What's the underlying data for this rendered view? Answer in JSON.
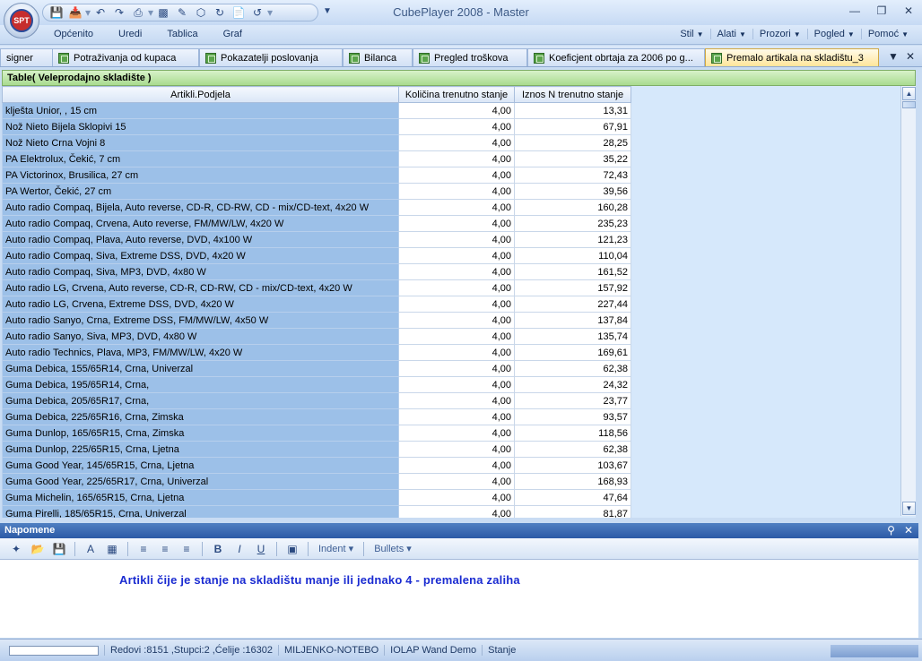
{
  "app": {
    "title": "CubePlayer 2008 - Master",
    "logo_text": "SPT"
  },
  "ribbon": {
    "left_menu": [
      "Općenito",
      "Uredi",
      "Tablica",
      "Graf"
    ],
    "right_menu": [
      "Stil",
      "Alati",
      "Prozori",
      "Pogled",
      "Pomoć"
    ]
  },
  "tabs": [
    {
      "label": "signer",
      "icon": "none"
    },
    {
      "label": "Potraživanja od kupaca",
      "icon": "sheet-icon"
    },
    {
      "label": "Pokazatelji poslovanja",
      "icon": "sheet-icon"
    },
    {
      "label": "Bilanca",
      "icon": "sheet-icon"
    },
    {
      "label": "Pregled troškova",
      "icon": "sheet-icon"
    },
    {
      "label": "Koeficjent obrtaja za 2006 po g...",
      "icon": "sheet-icon"
    },
    {
      "label": "Premalo artikala na skladištu_3",
      "icon": "sheet-icon",
      "active": true
    }
  ],
  "panel": {
    "title": "Table( Veleprodajno skladište )"
  },
  "grid": {
    "columns": [
      "Artikli.Podjela",
      "Količina trenutno stanje",
      "Iznos N trenutno stanje"
    ],
    "rows": [
      [
        "klješta Unior, , 15 cm",
        "4,00",
        "13,31"
      ],
      [
        "Nož Nieto Bijela Sklopivi 15",
        "4,00",
        "67,91"
      ],
      [
        "Nož Nieto Crna Vojni 8",
        "4,00",
        "28,25"
      ],
      [
        "PA Elektrolux, Čekić, 7 cm",
        "4,00",
        "35,22"
      ],
      [
        "PA Victorinox, Brusilica, 27 cm",
        "4,00",
        "72,43"
      ],
      [
        "PA Wertor, Čekić, 27 cm",
        "4,00",
        "39,56"
      ],
      [
        "Auto radio Compaq, Bijela, Auto reverse, CD-R, CD-RW, CD - mix/CD-text, 4x20 W",
        "4,00",
        "160,28"
      ],
      [
        "Auto radio Compaq, Crvena, Auto reverse, FM/MW/LW, 4x20 W",
        "4,00",
        "235,23"
      ],
      [
        "Auto radio Compaq, Plava, Auto reverse, DVD, 4x100 W",
        "4,00",
        "121,23"
      ],
      [
        "Auto radio Compaq, Siva, Extreme DSS, DVD, 4x20 W",
        "4,00",
        "110,04"
      ],
      [
        "Auto radio Compaq, Siva, MP3, DVD, 4x80 W",
        "4,00",
        "161,52"
      ],
      [
        "Auto radio LG, Crvena, Auto reverse, CD-R, CD-RW, CD - mix/CD-text, 4x20 W",
        "4,00",
        "157,92"
      ],
      [
        "Auto radio LG, Crvena, Extreme DSS, DVD, 4x20 W",
        "4,00",
        "227,44"
      ],
      [
        "Auto radio Sanyo, Crna, Extreme DSS, FM/MW/LW, 4x50 W",
        "4,00",
        "137,84"
      ],
      [
        "Auto radio Sanyo, Siva, MP3, DVD, 4x80 W",
        "4,00",
        "135,74"
      ],
      [
        "Auto radio Technics, Plava, MP3, FM/MW/LW, 4x20 W",
        "4,00",
        "169,61"
      ],
      [
        "Guma Debica, 155/65R14, Crna, Univerzal",
        "4,00",
        "62,38"
      ],
      [
        "Guma Debica, 195/65R14, Crna,",
        "4,00",
        "24,32"
      ],
      [
        "Guma Debica, 205/65R17, Crna,",
        "4,00",
        "23,77"
      ],
      [
        "Guma Debica, 225/65R16, Crna, Zimska",
        "4,00",
        "93,57"
      ],
      [
        "Guma Dunlop, 165/65R15, Crna, Zimska",
        "4,00",
        "118,56"
      ],
      [
        "Guma Dunlop, 225/65R15, Crna, Ljetna",
        "4,00",
        "62,38"
      ],
      [
        "Guma Good Year, 145/65R15, Crna, Ljetna",
        "4,00",
        "103,67"
      ],
      [
        "Guma Good Year, 225/65R17, Crna, Univerzal",
        "4,00",
        "168,93"
      ],
      [
        "Guma Michelin, 165/65R15, Crna, Ljetna",
        "4,00",
        "47,64"
      ],
      [
        "Guma Pirelli, 185/65R15, Crna, Univerzal",
        "4,00",
        "81,87"
      ]
    ]
  },
  "notes": {
    "title": "Napomene",
    "toolbar_indent": "Indent",
    "toolbar_bullets": "Bullets",
    "text": "Artikli čije je stanje na skladištu manje ili jednako 4 - premalena zaliha"
  },
  "status": {
    "counts": "Redovi :8151 ,Stupci:2 ,Ćelije :16302",
    "machine": "MILJENKO-NOTEBO",
    "server": "IOLAP Wand Demo",
    "state": "Stanje"
  }
}
